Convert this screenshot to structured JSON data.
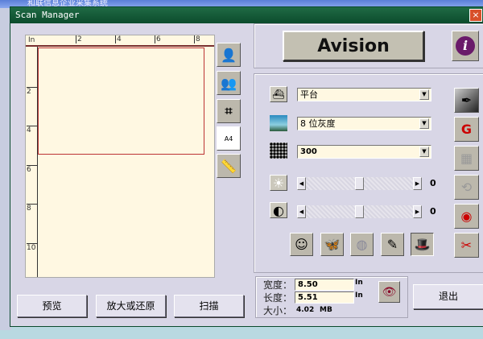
{
  "background_window": {
    "title": "和联信息企业采集系统"
  },
  "window": {
    "title": "Scan Manager",
    "close_label": "×"
  },
  "preview": {
    "unit": "In",
    "top_ticks": [
      "2",
      "4",
      "6",
      "8"
    ],
    "left_ticks": [
      "2",
      "4",
      "6",
      "8",
      "10"
    ]
  },
  "tools": [
    {
      "icon": "portrait-icon"
    },
    {
      "icon": "multi-portrait-icon"
    },
    {
      "icon": "crop-icon"
    },
    {
      "icon": "paper-size-icon"
    },
    {
      "icon": "ruler-icon"
    }
  ],
  "brand": {
    "label": "Avision",
    "info_label": "i"
  },
  "settings": {
    "source": {
      "icon": "flatbed-icon",
      "value": "平台"
    },
    "mode": {
      "icon": "image-type-icon",
      "value": "8 位灰度"
    },
    "resolution": {
      "icon": "halftone-icon",
      "value": "300"
    },
    "brightness": {
      "icon": "brightness-icon",
      "value": "0",
      "level": 0.5
    },
    "contrast": {
      "icon": "contrast-icon",
      "value": "0",
      "level": 0.5
    }
  },
  "effect_buttons": [
    {
      "icon": "faces-icon"
    },
    {
      "icon": "butterfly-icon"
    },
    {
      "icon": "descreen-icon"
    },
    {
      "icon": "eyedropper-icon"
    },
    {
      "icon": "magic-hat-icon"
    }
  ],
  "side_buttons": [
    {
      "icon": "color-dropper-icon"
    },
    {
      "icon": "gamma-curve-icon"
    },
    {
      "icon": "filter-icon"
    },
    {
      "icon": "rotate-icon"
    },
    {
      "icon": "color-eye-icon"
    },
    {
      "icon": "tools-knife-icon"
    }
  ],
  "size": {
    "width_label": "宽度：",
    "width": "8.50",
    "height_label": "长度：",
    "height": "5.51",
    "unit": "In",
    "size_label": "大小：",
    "size": "4.02",
    "size_unit": "MB"
  },
  "buttons": {
    "preview": "预览",
    "zoom": "放大或还原",
    "scan": "扫描",
    "exit": "退出"
  }
}
